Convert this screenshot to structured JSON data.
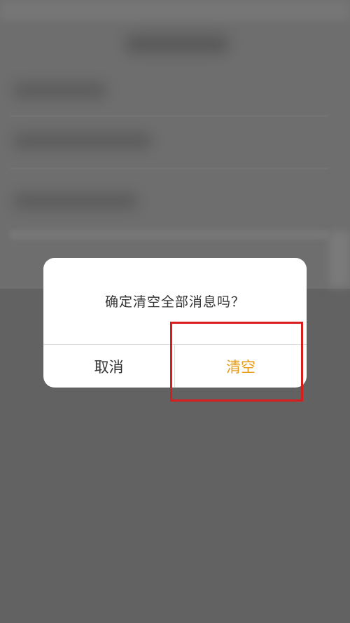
{
  "dialog": {
    "message": "确定清空全部消息吗？",
    "cancel_label": "取消",
    "confirm_label": "清空"
  },
  "colors": {
    "overlay": "#5f5f5f",
    "dialog_background": "#ffffff",
    "confirm_text": "#e89a16",
    "cancel_text": "#333333",
    "highlight": "#d91c1c"
  }
}
